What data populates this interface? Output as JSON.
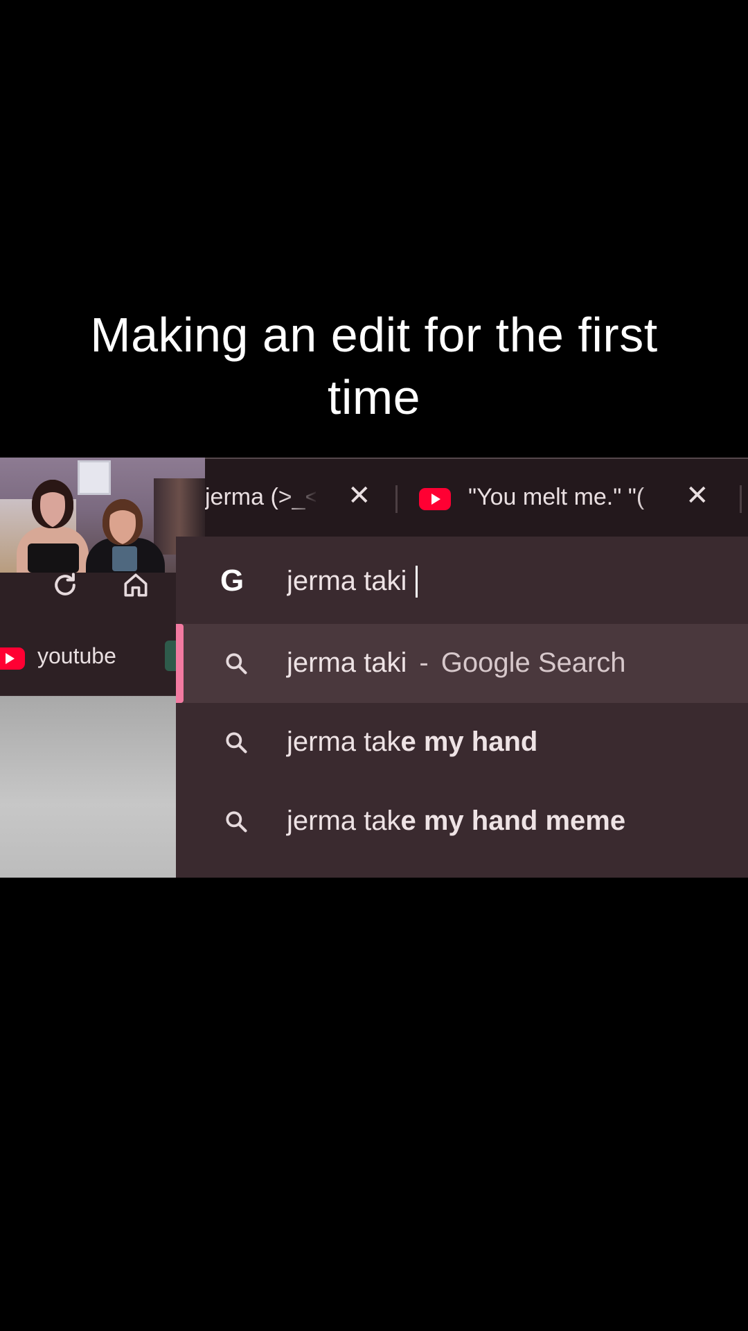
{
  "caption": {
    "line1": "Making an edit for the first",
    "line2": "time"
  },
  "tabs": [
    {
      "title": "jerma (>_<",
      "close": "✕"
    },
    {
      "title": "\"You melt me.\" \"(",
      "close": "✕",
      "icon": "youtube-icon"
    }
  ],
  "bookmarks": {
    "youtube_label": "youtube"
  },
  "omnibox": {
    "engine_icon": "G",
    "query": "jerma taki",
    "suggestions": [
      {
        "text": "jerma taki",
        "separator": "-",
        "description": "Google Search",
        "selected": true
      },
      {
        "text_plain": "jerma tak",
        "text_bold": "e my hand",
        "selected": false
      },
      {
        "text_plain": "jerma tak",
        "text_bold": "e my hand meme",
        "selected": false
      }
    ]
  },
  "colors": {
    "background": "#000000",
    "tabstrip": "#23181c",
    "omnibox": "#3a2a2f",
    "selected_row": "#4a383d",
    "accent": "#f27aa1",
    "youtube_red": "#ff0033"
  }
}
